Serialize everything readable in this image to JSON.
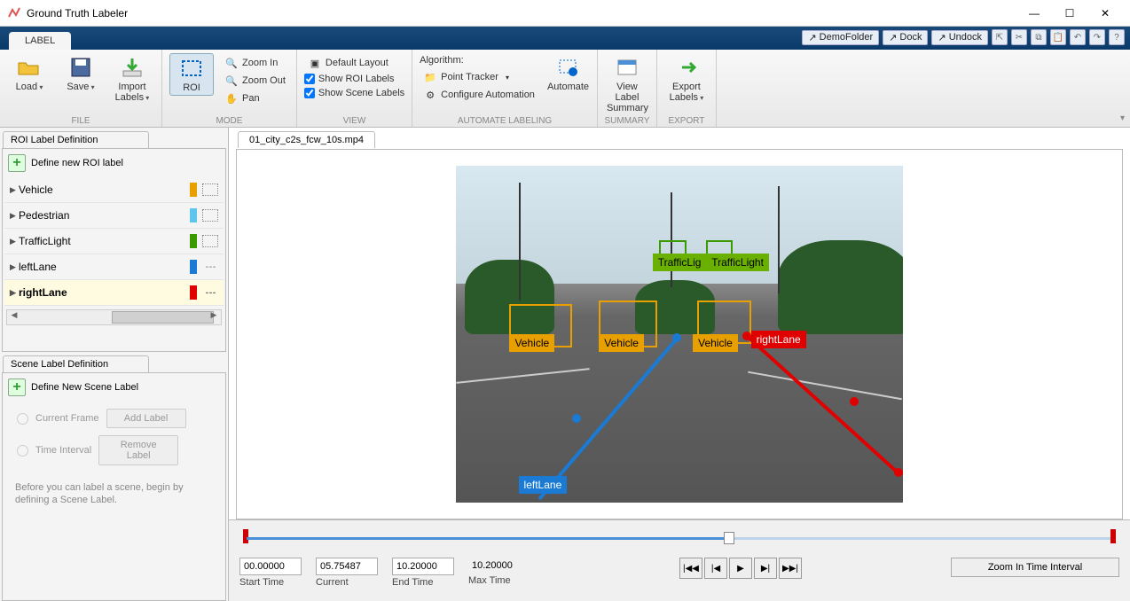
{
  "window": {
    "title": "Ground Truth Labeler"
  },
  "tab": {
    "label": "LABEL"
  },
  "toolstrip_links": {
    "demo": "DemoFolder",
    "dock": "Dock",
    "undock": "Undock"
  },
  "ribbon": {
    "file": {
      "label": "FILE",
      "load": "Load",
      "save": "Save",
      "import": "Import Labels"
    },
    "mode": {
      "label": "MODE",
      "roi": "ROI",
      "zoomin": "Zoom In",
      "zoomout": "Zoom Out",
      "pan": "Pan"
    },
    "view": {
      "label": "VIEW",
      "default_layout": "Default Layout",
      "show_roi": "Show ROI Labels",
      "show_scene": "Show Scene Labels"
    },
    "automate": {
      "label": "AUTOMATE LABELING",
      "algo": "Algorithm:",
      "tracker": "Point Tracker",
      "configure": "Configure Automation",
      "automate": "Automate"
    },
    "summary": {
      "label": "SUMMARY",
      "view": "View Label Summary"
    },
    "export": {
      "label": "EXPORT",
      "export": "Export Labels"
    }
  },
  "roi_panel": {
    "title": "ROI Label Definition",
    "define": "Define new ROI label",
    "items": [
      {
        "name": "Vehicle",
        "color": "#e8a000",
        "shape": "rect"
      },
      {
        "name": "Pedestrian",
        "color": "#5ec5ed",
        "shape": "rect"
      },
      {
        "name": "TrafficLight",
        "color": "#3a9a00",
        "shape": "rect"
      },
      {
        "name": "leftLane",
        "color": "#1a7ad4",
        "shape": "line"
      },
      {
        "name": "rightLane",
        "color": "#e00000",
        "shape": "line"
      }
    ],
    "selected": 4
  },
  "scene_panel": {
    "title": "Scene Label Definition",
    "define": "Define New Scene Label",
    "current_frame": "Current Frame",
    "time_interval": "Time Interval",
    "add": "Add Label",
    "remove": "Remove Label",
    "hint": "Before you can label a scene, begin by defining a Scene Label."
  },
  "document": {
    "tab": "01_city_c2s_fcw_10s.mp4"
  },
  "annotations": {
    "vehicle_label": "Vehicle",
    "trafficlight_label": "TrafficLight",
    "trafficlight_label_short": "TrafficLig",
    "leftlane_label": "leftLane",
    "rightlane_label": "rightLane"
  },
  "timeline": {
    "start": "00.00000",
    "start_cap": "Start Time",
    "current": "05.75487",
    "current_cap": "Current",
    "end": "10.20000",
    "end_cap": "End Time",
    "max": "10.20000",
    "max_cap": "Max Time",
    "zoom": "Zoom In Time Interval"
  }
}
